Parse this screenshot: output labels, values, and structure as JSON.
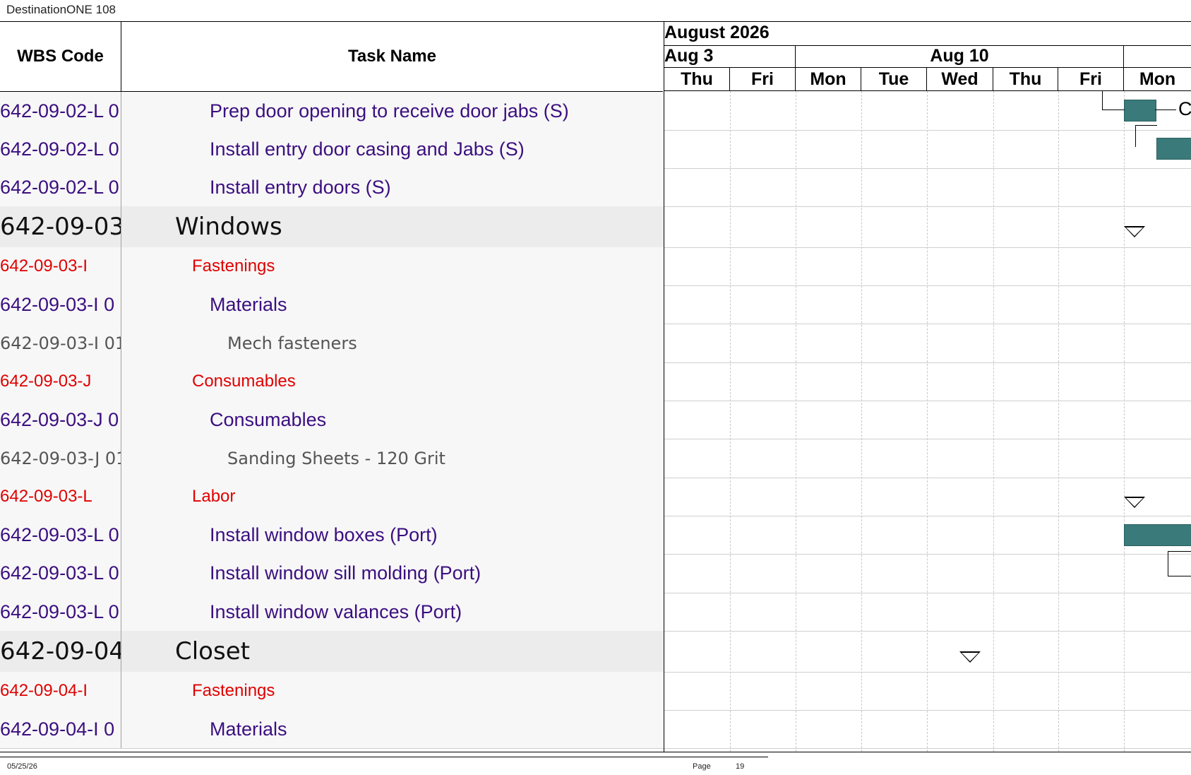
{
  "header": {
    "title": "DestinationONE 108"
  },
  "table": {
    "columns": {
      "wbs": "WBS Code",
      "task": "Task Name"
    },
    "rows": [
      {
        "wbs": "642-09-02-L 0",
        "task": "Prep door opening to receive door jabs (S)",
        "level": "purple"
      },
      {
        "wbs": "642-09-02-L 0",
        "task": "Install entry door casing and Jabs (S)",
        "level": "purple"
      },
      {
        "wbs": "642-09-02-L 0",
        "task": "Install entry doors (S)",
        "level": "purple"
      },
      {
        "wbs": "642-09-03",
        "task": "Windows",
        "level": "black"
      },
      {
        "wbs": "642-09-03-I",
        "task": "Fastenings",
        "level": "red"
      },
      {
        "wbs": "642-09-03-I 0",
        "task": "Materials",
        "level": "purple"
      },
      {
        "wbs": "642-09-03-I 01",
        "task": "Mech fasteners",
        "level": "gray"
      },
      {
        "wbs": "642-09-03-J",
        "task": "Consumables",
        "level": "red"
      },
      {
        "wbs": "642-09-03-J 0",
        "task": "Consumables",
        "level": "purple"
      },
      {
        "wbs": "642-09-03-J 01",
        "task": "Sanding Sheets - 120 Grit",
        "level": "gray"
      },
      {
        "wbs": "642-09-03-L",
        "task": "Labor",
        "level": "red"
      },
      {
        "wbs": "642-09-03-L 0",
        "task": "Install window boxes (Port)",
        "level": "purple"
      },
      {
        "wbs": "642-09-03-L 0",
        "task": "Install window sill molding (Port)",
        "level": "purple"
      },
      {
        "wbs": "642-09-03-L 0",
        "task": "Install window valances (Port)",
        "level": "purple"
      },
      {
        "wbs": "642-09-04",
        "task": "Closet",
        "level": "black"
      },
      {
        "wbs": "642-09-04-I",
        "task": "Fastenings",
        "level": "red"
      },
      {
        "wbs": "642-09-04-I 0",
        "task": "Materials",
        "level": "purple"
      }
    ]
  },
  "gantt": {
    "month": "August 2026",
    "weeks": [
      "Aug 3",
      "Aug 10"
    ],
    "days": [
      "Thu",
      "Fri",
      "Mon",
      "Tue",
      "Wed",
      "Thu",
      "Fri",
      "Mon"
    ],
    "bar_color": "#3a7a7a",
    "partial_label": "C"
  },
  "footer": {
    "date": "05/25/26",
    "page_label": "Page",
    "page_number": "19"
  }
}
